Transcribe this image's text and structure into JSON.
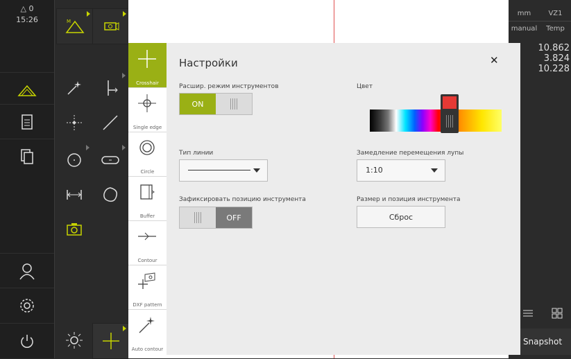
{
  "status": {
    "count": "△ 0",
    "time": "15:26"
  },
  "right_panel": {
    "headers": [
      "mm",
      "VZ1",
      "manual",
      "Temp"
    ],
    "coords": [
      "10.862",
      "3.824",
      "10.228"
    ],
    "snapshot_label": "Snapshot"
  },
  "toolstrip": {
    "items": [
      {
        "label": "Crosshair",
        "icon": "crosshair-icon"
      },
      {
        "label": "Single edge",
        "icon": "single-edge-icon"
      },
      {
        "label": "Circle",
        "icon": "circle-icon"
      },
      {
        "label": "Buffer",
        "icon": "buffer-icon"
      },
      {
        "label": "Contour",
        "icon": "contour-icon"
      },
      {
        "label": "DXF pattern",
        "icon": "dxf-pattern-icon"
      },
      {
        "label": "Auto contour",
        "icon": "auto-contour-icon"
      }
    ]
  },
  "dialog": {
    "title": "Настройки",
    "close": "✕",
    "ext_mode_label": "Расшир. режим инструментов",
    "ext_mode_value": "ON",
    "line_type_label": "Тип линии",
    "lock_position_label": "Зафиксировать позицию инструмента",
    "lock_position_value": "OFF",
    "color_label": "Цвет",
    "magnifier_label": "Замедление перемещения лупы",
    "magnifier_value": "1:10",
    "size_pos_label": "Размер и позиция инструмента",
    "reset_label": "Сброс"
  },
  "colors": {
    "accent": "#9ab015",
    "highlight": "#c8d500",
    "red_line": "#e05050"
  }
}
